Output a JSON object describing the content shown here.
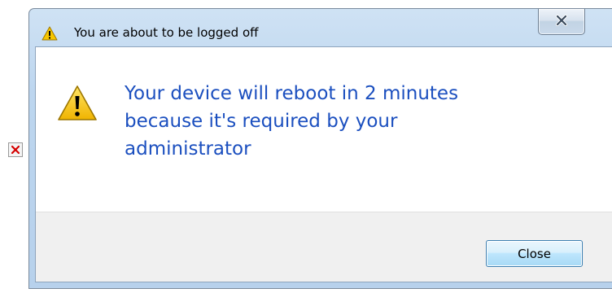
{
  "dialog": {
    "title": "You are about to be logged off",
    "message_lines": [
      "Your device will reboot in 2 minutes",
      "because it's required by your",
      "administrator"
    ],
    "close_button_label": "Close",
    "title_close_glyph": "X"
  },
  "icons": {
    "title_icon": "warning-icon",
    "message_icon": "warning-icon",
    "window_close": "close-icon",
    "broken_image": "broken-image-icon"
  },
  "colors": {
    "message_text": "#1b4fbf",
    "warning_yellow": "#f6c100",
    "titlebar": "#bdd6ef",
    "footer": "#f0f0f0"
  }
}
